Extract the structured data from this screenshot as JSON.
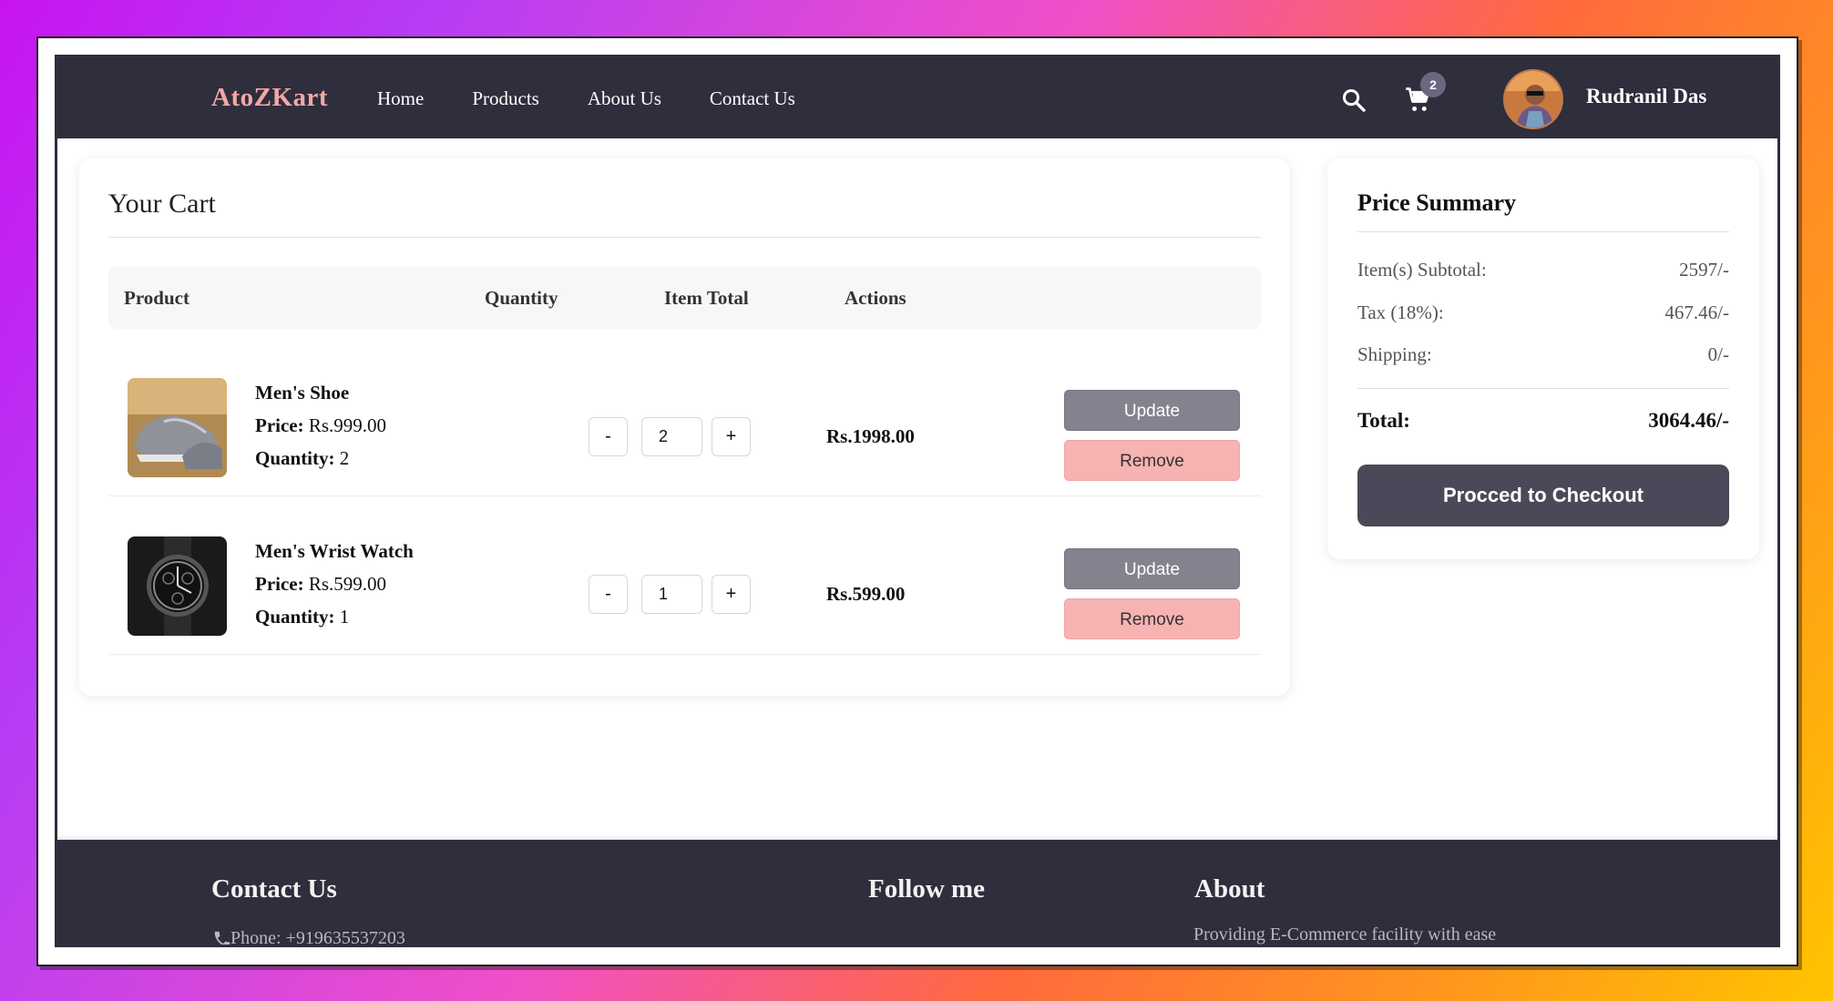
{
  "navbar": {
    "brand": "AtoZKart",
    "links": [
      "Home",
      "Products",
      "About Us",
      "Contact Us"
    ],
    "cart_count": "2",
    "user_name": "Rudranil Das"
  },
  "cart": {
    "title": "Your Cart",
    "columns": [
      "Product",
      "Quantity",
      "Item Total",
      "Actions"
    ],
    "items": [
      {
        "name": "Men's Shoe",
        "price_label": "Price:",
        "price": "Rs.999.00",
        "quantity_label": "Quantity:",
        "quantity": "2",
        "qty_value": "2",
        "item_total": "Rs.1998.00",
        "update_label": "Update",
        "remove_label": "Remove",
        "minus": "-",
        "plus": "+"
      },
      {
        "name": "Men's Wrist Watch",
        "price_label": "Price:",
        "price": "Rs.599.00",
        "quantity_label": "Quantity:",
        "quantity": "1",
        "qty_value": "1",
        "item_total": "Rs.599.00",
        "update_label": "Update",
        "remove_label": "Remove",
        "minus": "-",
        "plus": "+"
      }
    ]
  },
  "summary": {
    "title": "Price Summary",
    "rows": [
      {
        "label": "Item(s) Subtotal:",
        "value": "2597/-"
      },
      {
        "label": "Tax (18%):",
        "value": "467.46/-"
      },
      {
        "label": "Shipping:",
        "value": "0/-"
      }
    ],
    "total_label": "Total:",
    "total_value": "3064.46/-",
    "checkout_label": "Procced to Checkout"
  },
  "footer": {
    "contact_title": "Contact Us",
    "phone": "Phone: +919635537203",
    "follow_title": "Follow me",
    "about_title": "About",
    "about_text": "Providing E-Commerce facility with ease",
    "social_icons": [
      "github-icon",
      "linkedin-icon",
      "youtube-icon",
      "instagram-icon"
    ]
  },
  "colors": {
    "navbar_bg": "#2f2e3d",
    "brand": "#f4a7a7",
    "update_button": "#858290",
    "remove_button": "#f7b2b2",
    "checkout_button": "#4b4959"
  }
}
